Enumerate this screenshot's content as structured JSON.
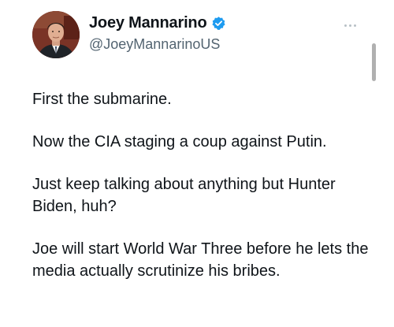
{
  "tweet": {
    "author": {
      "display_name": "Joey Mannarino",
      "handle": "@JoeyMannarinoUS",
      "verified_icon": "verified-badge-icon",
      "avatar_icon": "profile-photo"
    },
    "more_icon": "ellipsis-icon",
    "paragraphs": [
      "First the submarine.",
      "Now the CIA staging a coup against Putin.",
      "Just keep talking about anything but Hunter Biden, huh?",
      "Joe will start World War Three before he lets the media actually scrutinize his bribes."
    ]
  },
  "colors": {
    "text": "#0f1419",
    "secondary_text": "#536471",
    "verified_blue": "#1d9bf0",
    "background": "#ffffff"
  }
}
